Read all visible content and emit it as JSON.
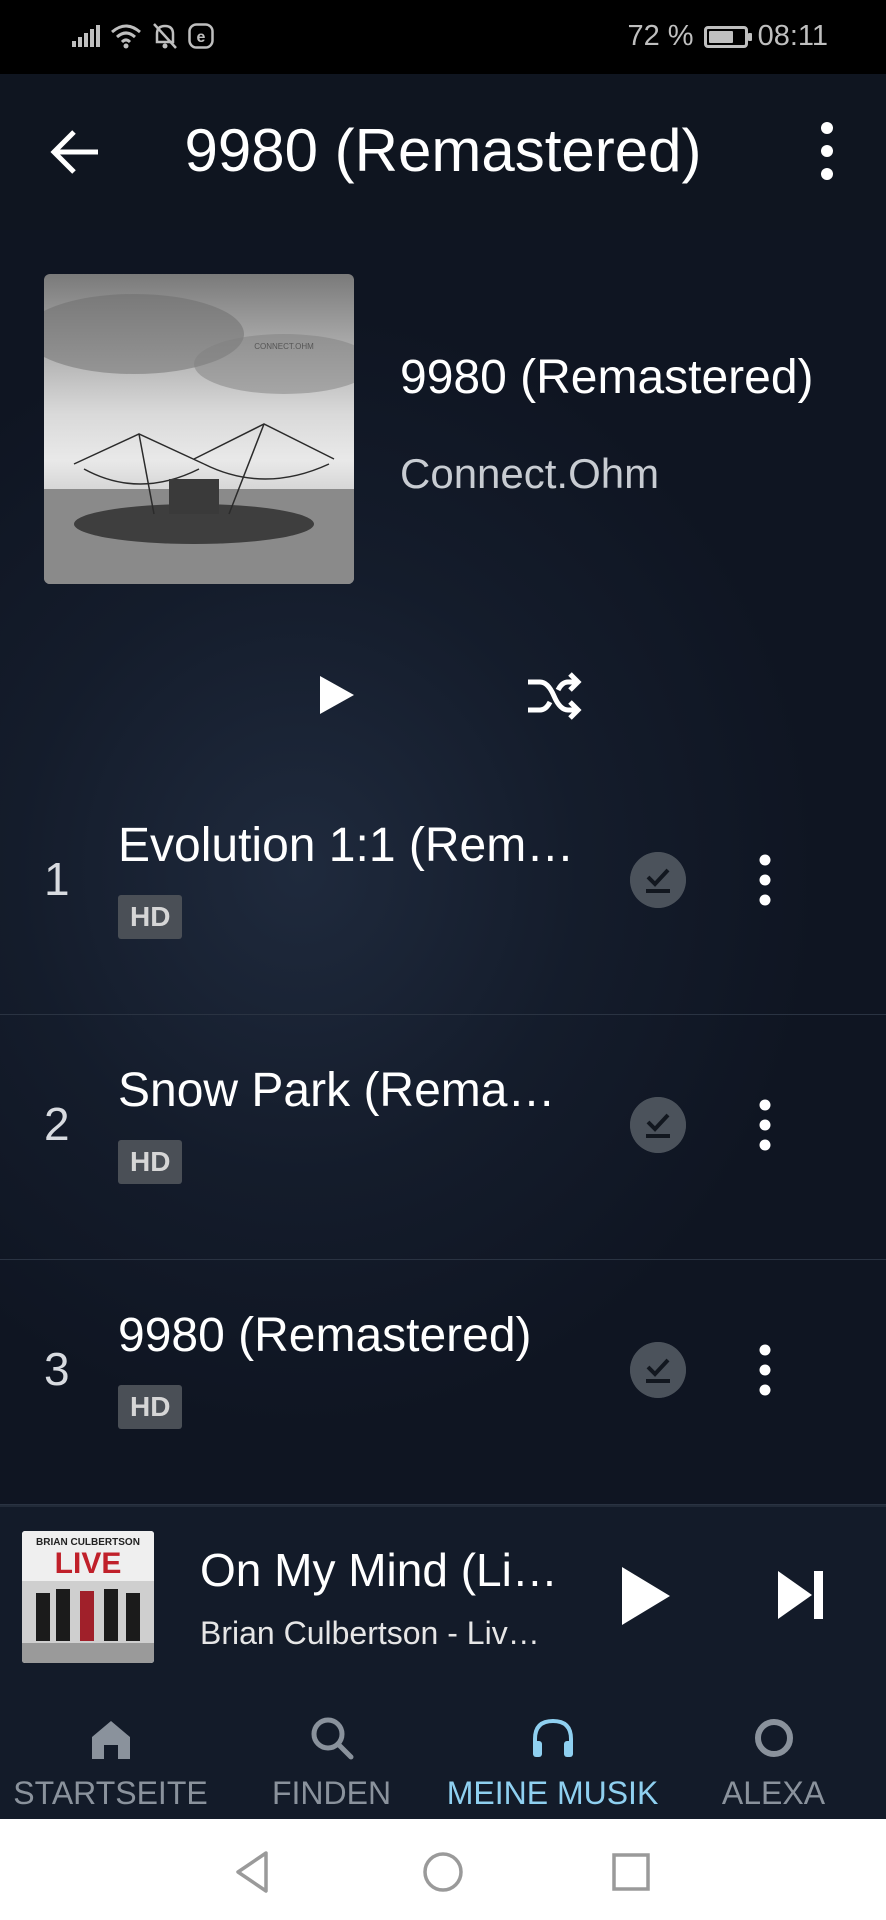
{
  "status_bar": {
    "battery": "72 %",
    "battery_level": 0.72,
    "time": "08:11"
  },
  "header": {
    "title": "9980 (Remastered)"
  },
  "album": {
    "title": "9980 (Remastered)",
    "artist": "Connect.Ohm",
    "cover_text": "CONNECT.OHM"
  },
  "tracks": [
    {
      "number": "1",
      "title": "Evolution 1:1 (Rem…",
      "badge": "HD"
    },
    {
      "number": "2",
      "title": "Snow Park (Rema…",
      "badge": "HD"
    },
    {
      "number": "3",
      "title": "9980 (Remastered)",
      "badge": "HD"
    }
  ],
  "now_playing": {
    "title": "On My Mind (Li…",
    "subtitle": "Brian Culbertson - Liv…",
    "art_artist": "BRIAN CULBERTSON",
    "art_title": "LIVE"
  },
  "bottom_nav": [
    {
      "label": "STARTSEITE",
      "icon": "home-icon",
      "active": false
    },
    {
      "label": "FINDEN",
      "icon": "search-icon",
      "active": false
    },
    {
      "label": "MEINE MUSIK",
      "icon": "headphones-icon",
      "active": true
    },
    {
      "label": "ALEXA",
      "icon": "alexa-ring-icon",
      "active": false
    }
  ],
  "colors": {
    "accent": "#8fd0f0",
    "background": "#0d1320",
    "badge": "#4a4f56"
  }
}
